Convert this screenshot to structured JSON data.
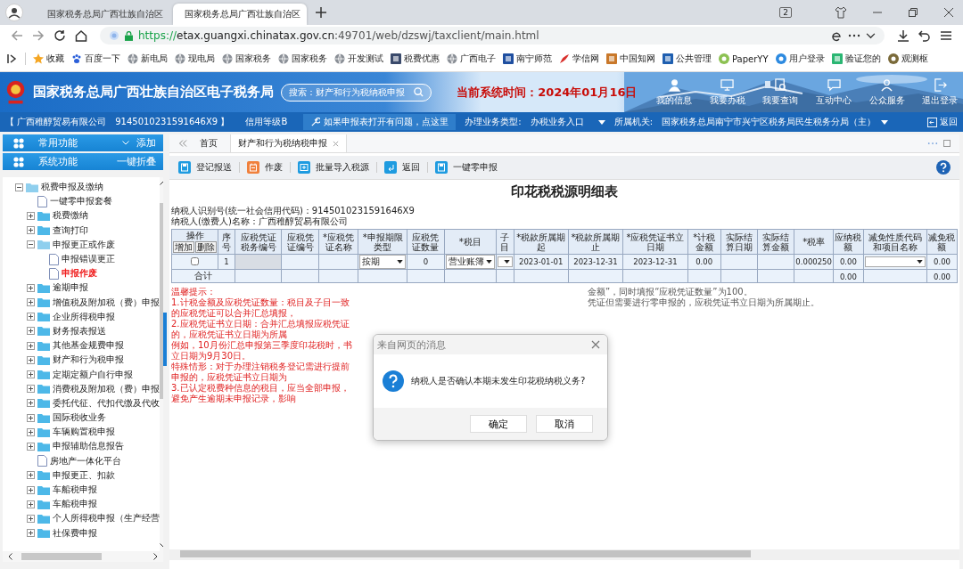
{
  "browser": {
    "tabs": [
      {
        "title": "国家税务总局广西壮族自治区",
        "selected": false
      },
      {
        "title": "国家税务总局广西壮族自治区",
        "selected": true
      }
    ],
    "tab_count": "2",
    "url_scheme": "https://",
    "url_host": "etax.guangxi.chinatax.gov.cn",
    "url_rest": ":49701/web/dzswj/taxclient/main.html",
    "bookmarks": [
      {
        "label": "收藏",
        "kind": "star"
      },
      {
        "label": "百度一下",
        "kind": "paw"
      },
      {
        "label": "新电局",
        "kind": "globe"
      },
      {
        "label": "现电局",
        "kind": "globe"
      },
      {
        "label": "国家税务",
        "kind": "globe"
      },
      {
        "label": "国家税务",
        "kind": "globe"
      },
      {
        "label": "开发测试",
        "kind": "globe"
      },
      {
        "label": "税费优惠",
        "kind": "tile",
        "color": "#3a4a6b"
      },
      {
        "label": "广西电子",
        "kind": "globe"
      },
      {
        "label": "南宁师范",
        "kind": "tile",
        "color": "#1f4fa0"
      },
      {
        "label": "学信网",
        "kind": "feather"
      },
      {
        "label": "中国知网",
        "kind": "tile",
        "color": "#c9782a"
      },
      {
        "label": "公共管理",
        "kind": "tile",
        "color": "#1f5fb0"
      },
      {
        "label": "PaperYY",
        "kind": "round",
        "color": "#8cc152"
      },
      {
        "label": "用户登录",
        "kind": "round",
        "color": "#2d8ae0"
      },
      {
        "label": "验证您的",
        "kind": "tile",
        "color": "#2bb673"
      },
      {
        "label": "观测枢",
        "kind": "round",
        "color": "#7a6a3a"
      }
    ]
  },
  "header": {
    "title": "国家税务总局广西壮族自治区电子税务局",
    "search_placeholder": "搜索：财产和行为税纳税申报",
    "system_time": "当前系统时间：2024年01月16日",
    "nav": [
      {
        "label": "我的信息",
        "kind": "person"
      },
      {
        "label": "我要办税",
        "kind": "monitor"
      },
      {
        "label": "我要查询",
        "kind": "search"
      },
      {
        "label": "互动中心",
        "kind": "chat"
      },
      {
        "label": "公众服务",
        "kind": "people"
      },
      {
        "label": "退出登录",
        "kind": "exit"
      }
    ]
  },
  "info_bar": {
    "company": "【 广西稚醇贸易有限公司",
    "tax_id": "9145010231591646X9 】",
    "credit": "信用等级B",
    "help_link": "如果申报表打开有问题，点这里",
    "business_type_label": "办理业务类型:",
    "business_type": "办税业务入口",
    "authority_label": "所属机关:",
    "authority": "国家税务总局南宁市兴宁区税务局民生税务分局（主）",
    "back": "返回"
  },
  "sidebar": {
    "groups": [
      {
        "label": "常用功能",
        "action": "添加",
        "caret": true
      },
      {
        "label": "系统功能",
        "action": "一键折叠",
        "caret": false
      }
    ],
    "tree": [
      {
        "label": "税费申报及缴纳",
        "kind": "folder",
        "expanded": true,
        "selected": false,
        "children": [
          {
            "label": "一键零申报套餐",
            "kind": "doc",
            "selected": false
          },
          {
            "label": "税费缴纳",
            "kind": "folder",
            "expanded": false,
            "selected": false
          },
          {
            "label": "查询打印",
            "kind": "folder",
            "expanded": false,
            "selected": false
          },
          {
            "label": "申报更正或作废",
            "kind": "folder",
            "expanded": true,
            "selected": false,
            "children": [
              {
                "label": "申报错误更正",
                "kind": "doc",
                "selected": false
              },
              {
                "label": "申报作废",
                "kind": "doc",
                "selected": true
              }
            ]
          },
          {
            "label": "逾期申报",
            "kind": "folder",
            "expanded": false,
            "selected": false
          },
          {
            "label": "增值税及附加税（费）申报",
            "kind": "folder",
            "expanded": false,
            "selected": false
          },
          {
            "label": "企业所得税申报",
            "kind": "folder",
            "expanded": false,
            "selected": false
          },
          {
            "label": "财务报表报送",
            "kind": "folder",
            "expanded": false,
            "selected": false
          },
          {
            "label": "其他基金规费申报",
            "kind": "folder",
            "expanded": false,
            "selected": false
          },
          {
            "label": "财产和行为税申报",
            "kind": "folder",
            "expanded": false,
            "selected": false
          },
          {
            "label": "定期定额户自行申报",
            "kind": "folder",
            "expanded": false,
            "selected": false
          },
          {
            "label": "消费税及附加税（费）申报",
            "kind": "folder",
            "expanded": false,
            "selected": false
          },
          {
            "label": "委托代征、代扣代缴及代收",
            "kind": "folder",
            "expanded": false,
            "selected": false
          },
          {
            "label": "国际税收业务",
            "kind": "folder",
            "expanded": false,
            "selected": false
          },
          {
            "label": "车辆购置税申报",
            "kind": "folder",
            "expanded": false,
            "selected": false
          },
          {
            "label": "申报辅助信息报告",
            "kind": "folder",
            "expanded": false,
            "selected": false
          },
          {
            "label": "房地产一体化平台",
            "kind": "doc",
            "selected": false
          },
          {
            "label": "申报更正、扣款",
            "kind": "folder",
            "expanded": false,
            "selected": false
          },
          {
            "label": "车船税申报",
            "kind": "folder",
            "expanded": false,
            "selected": false
          },
          {
            "label": "车船税申报",
            "kind": "folder",
            "expanded": false,
            "selected": false
          },
          {
            "label": "个人所得税申报（生产经营",
            "kind": "folder",
            "expanded": false,
            "selected": false
          },
          {
            "label": "社保费申报",
            "kind": "folder",
            "expanded": false,
            "selected": false
          }
        ]
      }
    ]
  },
  "page_tabs": [
    {
      "label": "首页",
      "selected": false,
      "closable": false
    },
    {
      "label": "财产和行为税纳税申报",
      "selected": true,
      "closable": true
    }
  ],
  "toolbar": [
    {
      "label": "登记报送",
      "kind": "save"
    },
    {
      "label": "作废",
      "kind": "void"
    },
    {
      "label": "批量导入税源",
      "kind": "import"
    },
    {
      "label": "返回",
      "kind": "back"
    },
    {
      "label": "一键零申报",
      "kind": "save"
    }
  ],
  "form": {
    "title": "印花税税源明细表",
    "taxpayer_id": "纳税人识别号(统一社会信用代码)：9145010231591646X9",
    "taxpayer_name": "纳税人(缴费人)名称：广西稚醇贸易有限公司",
    "columns": [
      {
        "label": "操作",
        "buttons": [
          "增加",
          "删除"
        ]
      },
      {
        "label": "序号"
      },
      {
        "label": "应税凭证税务编号"
      },
      {
        "label": "应税凭证编号"
      },
      {
        "label": "*应税凭证名称"
      },
      {
        "label": "*申报期限类型"
      },
      {
        "label": "应税凭证数量"
      },
      {
        "label": "*税目"
      },
      {
        "label": "子目"
      },
      {
        "label": "*税款所属期起"
      },
      {
        "label": "*税款所属期止"
      },
      {
        "label": "*应税凭证书立日期"
      },
      {
        "label": "*计税金额"
      },
      {
        "label": "实际结算日期"
      },
      {
        "label": "实际结算金额"
      },
      {
        "label": "*税率"
      },
      {
        "label": "应纳税额"
      },
      {
        "label": "减免性质代码和项目名称"
      },
      {
        "label": "减免税额"
      }
    ],
    "rows": [
      [
        {
          "kind": "check",
          "checked": false
        },
        {
          "kind": "text",
          "value": "1"
        },
        {
          "kind": "readonly"
        },
        {
          "kind": "input"
        },
        {
          "kind": "input"
        },
        {
          "kind": "select",
          "value": "按期"
        },
        {
          "kind": "text",
          "value": "0"
        },
        {
          "kind": "select",
          "value": "营业账簿"
        },
        {
          "kind": "select"
        },
        {
          "kind": "text",
          "value": "2023-01-01"
        },
        {
          "kind": "text",
          "value": "2023-12-31"
        },
        {
          "kind": "text",
          "value": "2023-12-31"
        },
        {
          "kind": "text",
          "value": "0.00"
        },
        {
          "kind": "input"
        },
        {
          "kind": "input"
        },
        {
          "kind": "text",
          "value": "0.000250"
        },
        {
          "kind": "text",
          "value": "0.00"
        },
        {
          "kind": "select"
        },
        {
          "kind": "text",
          "value": "0.00"
        }
      ]
    ],
    "total": {
      "label": "合计",
      "cells": [
        {
          "kind": "input"
        },
        {
          "kind": "input"
        },
        {
          "kind": "input"
        },
        {
          "kind": "input"
        },
        {
          "kind": "input"
        },
        {
          "kind": "input"
        },
        {
          "kind": "input"
        },
        {
          "kind": "input"
        },
        {
          "kind": "input"
        },
        {
          "kind": "input"
        },
        {
          "kind": "input"
        },
        {
          "kind": "input"
        },
        {
          "kind": "input"
        },
        {
          "kind": "input"
        },
        {
          "kind": "text",
          "value": "0.00"
        },
        {
          "kind": "input"
        },
        {
          "kind": "text",
          "value": "0.00"
        }
      ]
    },
    "notes_left": [
      "温馨提示：",
      "1.计税金额及应税凭证数量：税目及子目一致的应税凭证可以合并汇总填报，",
      "2.应税凭证书立日期：合并汇总填报应税凭证的，应税凭证书立日期为所属",
      "例如，10月份汇总申报第三季度印花税时，书立日期为9月30日。",
      "特殊情形：对于办理注销税务登记需进行提前申报的，应税凭证书立日期为",
      "3.已认定税费种信息的税目，应当全部申报，避免产生逾期未申报记录，影响"
    ],
    "notes_right": [
      "金额”，同时填报“应税凭证数量”为100。",
      "凭证但需要进行零申报的，应税凭证书立日期为所属期止。"
    ]
  },
  "dialog": {
    "title": "来自网页的消息",
    "message": "纳税人是否确认本期未发生印花税纳税义务?",
    "buttons": [
      "确定",
      "取消"
    ]
  }
}
